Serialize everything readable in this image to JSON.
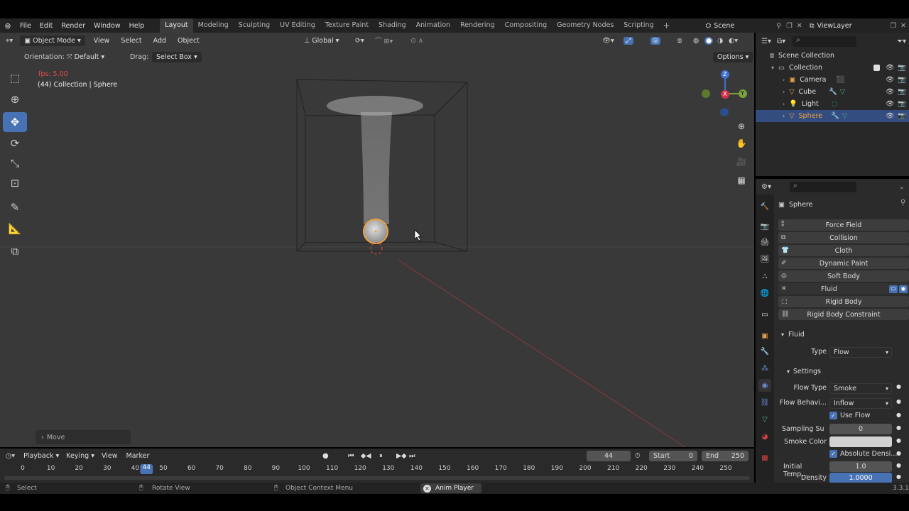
{
  "topbar": {
    "menus": [
      "File",
      "Edit",
      "Render",
      "Window",
      "Help"
    ],
    "workspaces": [
      "Layout",
      "Modeling",
      "Sculpting",
      "UV Editing",
      "Texture Paint",
      "Shading",
      "Animation",
      "Rendering",
      "Compositing",
      "Geometry Nodes",
      "Scripting"
    ],
    "active_workspace": "Layout",
    "scene": "Scene",
    "view_layer": "ViewLayer"
  },
  "viewport": {
    "mode": "Object Mode",
    "menus": [
      "View",
      "Select",
      "Add",
      "Object"
    ],
    "transform_orientation": "Global",
    "orientation_label": "Orientation:",
    "orientation_value": "Default",
    "drag_label": "Drag:",
    "drag_value": "Select Box",
    "options": "Options",
    "fps": "fps: 5.00",
    "info": "(44) Collection | Sphere",
    "last_op": "Move",
    "gizmo": {
      "x": "X",
      "y": "Y",
      "z": "Z"
    }
  },
  "outliner": {
    "root": "Scene Collection",
    "collection": "Collection",
    "objects": [
      "Camera",
      "Cube",
      "Light",
      "Sphere"
    ],
    "selected": "Sphere"
  },
  "properties": {
    "object": "Sphere",
    "physics_buttons": [
      "Force Field",
      "Collision",
      "Cloth",
      "Dynamic Paint",
      "Soft Body",
      "Fluid",
      "Rigid Body",
      "Rigid Body Constraint"
    ],
    "fluid_panel": "Fluid",
    "type_label": "Type",
    "type_value": "Flow",
    "settings_panel": "Settings",
    "flow_type_label": "Flow Type",
    "flow_type_value": "Smoke",
    "flow_behavior_label": "Flow Behavi...",
    "flow_behavior_value": "Inflow",
    "use_flow": "Use Flow",
    "sampling_label": "Sampling Su",
    "sampling_value": "0",
    "smoke_color_label": "Smoke Color",
    "absolute_density": "Absolute Densi...",
    "initial_temp_label": "Initial Temp...",
    "initial_temp_value": "1.0",
    "density_label": "Density",
    "density_value": "1.0000",
    "colors": {
      "smoke_color": "#d2d2d2",
      "active_blue": "#4772b3"
    }
  },
  "timeline": {
    "menus": [
      "Playback",
      "Keying",
      "View",
      "Marker"
    ],
    "current_frame": "44",
    "start_label": "Start",
    "start_value": "0",
    "end_label": "End",
    "end_value": "250",
    "ticks": [
      "0",
      "10",
      "20",
      "30",
      "40",
      "50",
      "60",
      "70",
      "80",
      "90",
      "100",
      "110",
      "120",
      "130",
      "140",
      "150",
      "160",
      "170",
      "180",
      "190",
      "200",
      "210",
      "220",
      "230",
      "240",
      "250"
    ]
  },
  "statusbar": {
    "select": "Select",
    "rotate": "Rotate View",
    "context": "Object Context Menu",
    "anim": "Anim Player",
    "version": "3.3.1"
  }
}
